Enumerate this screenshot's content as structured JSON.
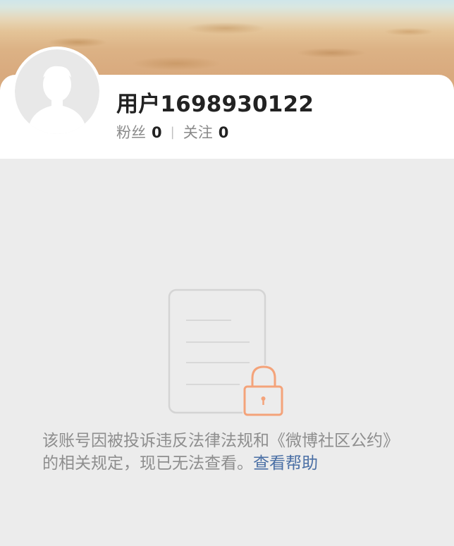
{
  "profile": {
    "username": "用户1698930122",
    "fans_label": "粉丝",
    "fans_count": "0",
    "separator": "|",
    "following_label": "关注",
    "following_count": "0"
  },
  "notice": {
    "message": "该账号因被投诉违反法律法规和《微博社区公约》的相关规定，现已无法查看。",
    "help_link": "查看帮助"
  },
  "icons": {
    "avatar": "default-avatar-silhouette",
    "illustration": "locked-document-icon"
  },
  "colors": {
    "background": "#ececec",
    "card": "#ffffff",
    "username": "#222222",
    "muted_text": "#8e8e8e",
    "link": "#4a6fa5",
    "lock_accent": "#f4a37a",
    "document_outline": "#d4d4d4"
  }
}
